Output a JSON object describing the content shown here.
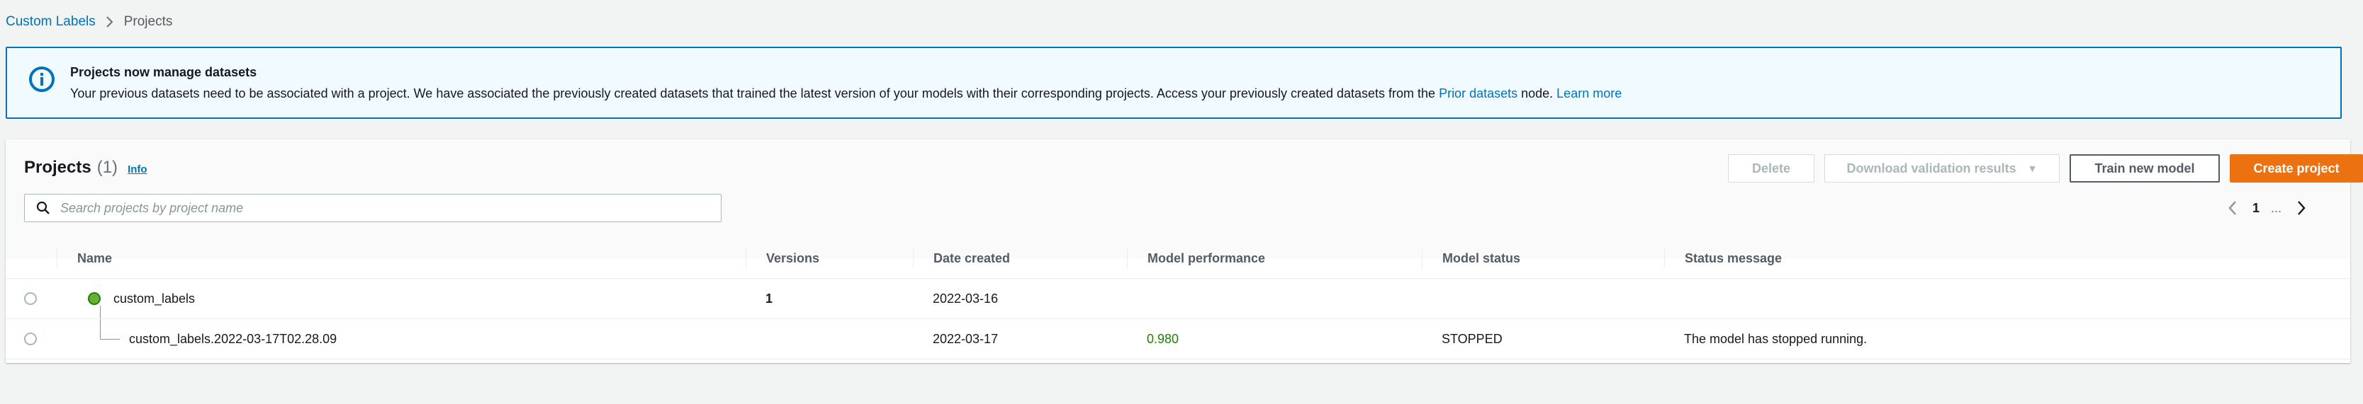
{
  "breadcrumb": {
    "root": "Custom Labels",
    "current": "Projects"
  },
  "flash": {
    "icon": "info-icon",
    "title": "Projects now manage datasets",
    "message_pre": "Your previous datasets need to be associated with a project. We have associated the previously created datasets that trained the latest version of your models with their corresponding projects. Access your previously created datasets from the ",
    "link_prior": "Prior datasets",
    "message_mid": " node. ",
    "link_learn": "Learn more"
  },
  "panel": {
    "title": "Projects",
    "count": "(1)",
    "info_link": "Info"
  },
  "actions": {
    "delete": "Delete",
    "download": "Download validation results",
    "train": "Train new model",
    "create": "Create project"
  },
  "search": {
    "placeholder": "Search projects by project name",
    "value": ""
  },
  "pagination": {
    "page": "1",
    "ellipsis": "..."
  },
  "table": {
    "headers": {
      "name": "Name",
      "versions": "Versions",
      "date_created": "Date created",
      "model_performance": "Model performance",
      "model_status": "Model status",
      "status_message": "Status message"
    },
    "rows": [
      {
        "name": "custom_labels",
        "versions": "1",
        "date_created": "2022-03-16",
        "model_performance": "",
        "model_status": "",
        "status_message": ""
      },
      {
        "name": "custom_labels.2022-03-17T02.28.09",
        "versions": "",
        "date_created": "2022-03-17",
        "model_performance": "0.980",
        "model_status": "STOPPED",
        "status_message": "The model has stopped running."
      }
    ]
  },
  "colors": {
    "link": "#0073bb",
    "primary": "#ec7211",
    "success": "#1d8102",
    "flash_bg": "#f1faff",
    "flash_border": "#0073bb"
  }
}
